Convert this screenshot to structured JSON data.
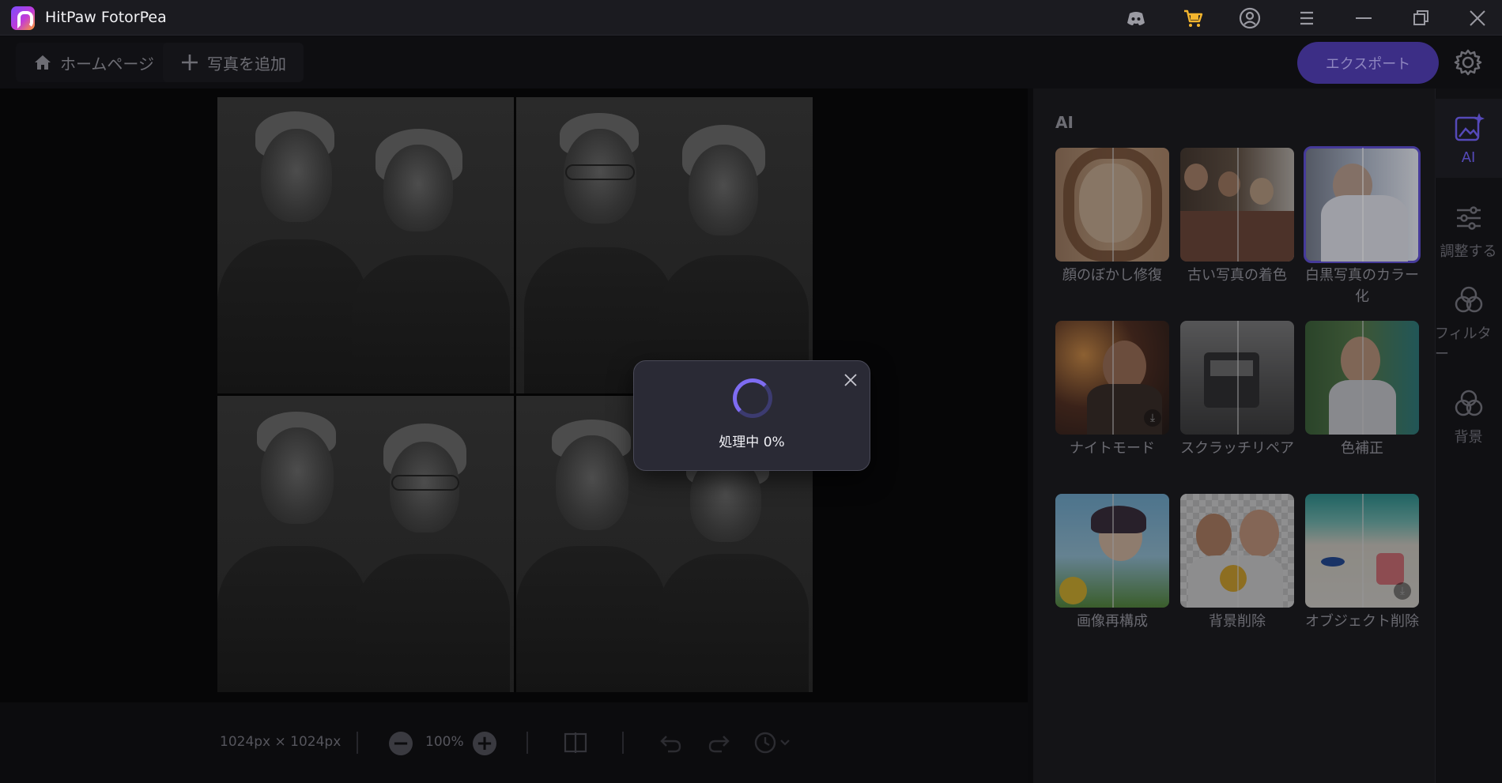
{
  "app": {
    "title": "HitPaw FotorPea"
  },
  "titlebar": {
    "icons": [
      "discord-icon",
      "cart-icon",
      "account-icon",
      "menu-icon",
      "minimize-icon",
      "restore-icon",
      "close-icon"
    ]
  },
  "toolbar": {
    "home_label": "ホームページ",
    "add_photo_label": "写真を追加",
    "export_label": "エクスポート"
  },
  "canvas": {
    "size_text": "1024px × 1024px",
    "zoom_text": "100%"
  },
  "panel": {
    "title": "AI",
    "cards": [
      {
        "label": "顔のぼかし修復",
        "selected": false
      },
      {
        "label": "古い写真の着色",
        "selected": false
      },
      {
        "label": "白黒写真のカラー化",
        "selected": true
      },
      {
        "label": "ナイトモード",
        "selected": false
      },
      {
        "label": "スクラッチリペア",
        "selected": false
      },
      {
        "label": "色補正",
        "selected": false
      },
      {
        "label": "画像再構成",
        "selected": false
      },
      {
        "label": "背景削除",
        "selected": false
      },
      {
        "label": "オブジェクト削除",
        "selected": false
      }
    ]
  },
  "sidenav": {
    "items": [
      {
        "label": "AI",
        "active": true
      },
      {
        "label": "調整する",
        "active": false
      },
      {
        "label": "フィルター",
        "active": false
      },
      {
        "label": "背景",
        "active": false
      }
    ]
  },
  "dialog": {
    "status_text": "処理中 0%",
    "progress": 0
  },
  "colors": {
    "accent": "#5b4bd1",
    "dialog_bg": "#2a2a35",
    "panel_bg": "#141417"
  }
}
